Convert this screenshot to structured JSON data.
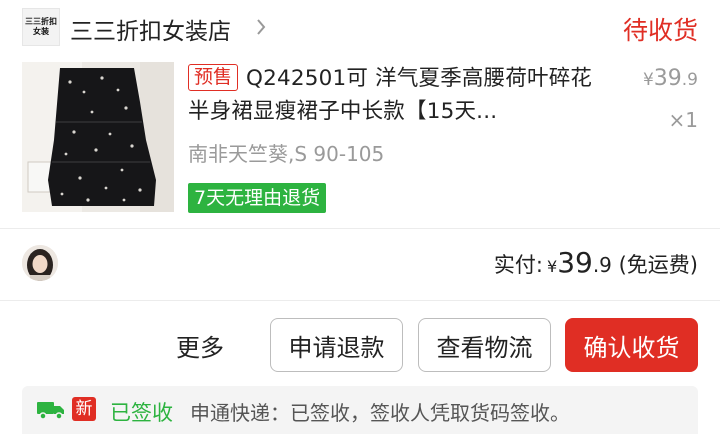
{
  "shop": {
    "logo_line1": "三三折扣",
    "logo_line2": "女装",
    "name": "三三折扣女装店",
    "order_status": "待收货"
  },
  "product": {
    "presale_tag": "预售",
    "title": "Q242501可 洋气夏季高腰荷叶碎花半身裙显瘦裙子中长款【15天...",
    "price_symbol": "¥",
    "price_int": "39",
    "price_dec": ".9",
    "quantity": "×1",
    "sku": "南非天竺葵,S 90-105",
    "return_policy": "7天无理由退货"
  },
  "summary": {
    "paid_label": "实付:",
    "currency": "¥",
    "amount_int": "39",
    "amount_dec": ".9",
    "shipping_note": "(免运费)"
  },
  "actions": {
    "more": "更多",
    "refund": "申请退款",
    "logistics": "查看物流",
    "confirm": "确认收货"
  },
  "logistics": {
    "badge": "新",
    "status": "已签收",
    "detail": "申通快递：已签收，签收人凭取货码签收。"
  },
  "colors": {
    "accent_red": "#e02e24",
    "success_green": "#2db340",
    "muted_gray": "#9a9a9a"
  }
}
